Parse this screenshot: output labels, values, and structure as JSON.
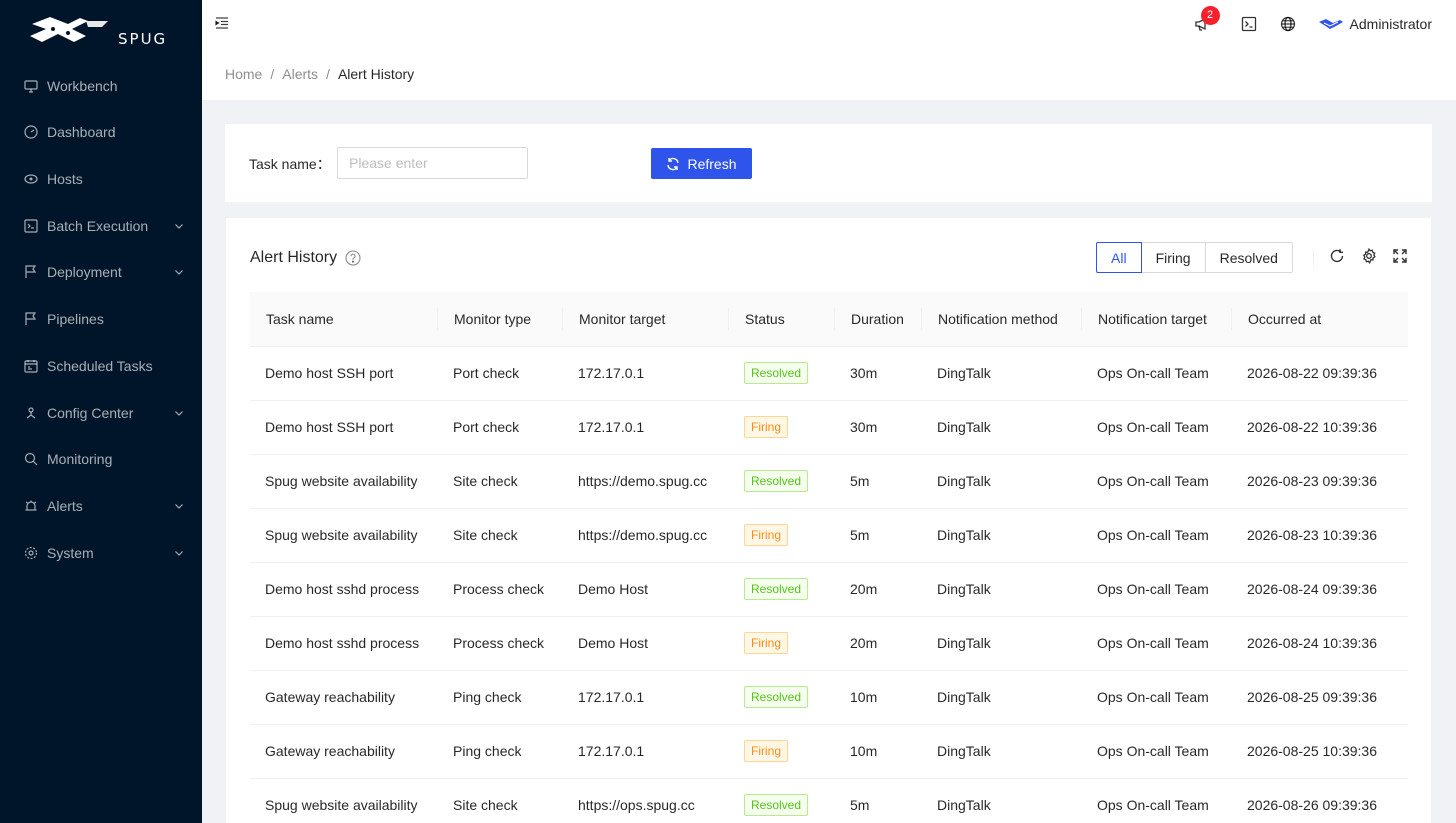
{
  "brand": {
    "logo_text": "SPUG"
  },
  "sidebar": {
    "items": [
      {
        "label": "Workbench",
        "icon": "desktop-icon",
        "has_children": false
      },
      {
        "label": "Dashboard",
        "icon": "dashboard-icon",
        "has_children": false
      },
      {
        "label": "Hosts",
        "icon": "cloud-server-icon",
        "has_children": false
      },
      {
        "label": "Batch Execution",
        "icon": "code-icon",
        "has_children": true
      },
      {
        "label": "Deployment",
        "icon": "flag-icon",
        "has_children": true
      },
      {
        "label": "Pipelines",
        "icon": "flag-icon",
        "has_children": false
      },
      {
        "label": "Scheduled Tasks",
        "icon": "schedule-icon",
        "has_children": false
      },
      {
        "label": "Config Center",
        "icon": "deployment-unit-icon",
        "has_children": true
      },
      {
        "label": "Monitoring",
        "icon": "monitor-icon",
        "has_children": false
      },
      {
        "label": "Alerts",
        "icon": "alert-icon",
        "has_children": true
      },
      {
        "label": "System",
        "icon": "setting-icon",
        "has_children": true
      }
    ]
  },
  "header": {
    "notification_count": "2",
    "username": "Administrator"
  },
  "breadcrumb": [
    "Home",
    "Alerts",
    "Alert History"
  ],
  "search": {
    "label": "Task name：",
    "placeholder": "Please enter",
    "refresh_label": "Refresh"
  },
  "table": {
    "title": "Alert History",
    "filters": [
      "All",
      "Firing",
      "Resolved"
    ],
    "active_filter": "All",
    "columns": [
      "Task name",
      "Monitor type",
      "Monitor target",
      "Status",
      "Duration",
      "Notification method",
      "Notification target",
      "Occurred at"
    ],
    "rows": [
      {
        "name": "Demo host SSH port",
        "type": "Port check",
        "target": "172.17.0.1",
        "status": "Resolved",
        "duration": "30m",
        "method": "DingTalk",
        "notify": "Ops On-call Team",
        "time": "2026-08-22 09:39:36"
      },
      {
        "name": "Demo host SSH port",
        "type": "Port check",
        "target": "172.17.0.1",
        "status": "Firing",
        "duration": "30m",
        "method": "DingTalk",
        "notify": "Ops On-call Team",
        "time": "2026-08-22 10:39:36"
      },
      {
        "name": "Spug website availability",
        "type": "Site check",
        "target": "https://demo.spug.cc",
        "status": "Resolved",
        "duration": "5m",
        "method": "DingTalk",
        "notify": "Ops On-call Team",
        "time": "2026-08-23 09:39:36"
      },
      {
        "name": "Spug website availability",
        "type": "Site check",
        "target": "https://demo.spug.cc",
        "status": "Firing",
        "duration": "5m",
        "method": "DingTalk",
        "notify": "Ops On-call Team",
        "time": "2026-08-23 10:39:36"
      },
      {
        "name": "Demo host sshd process",
        "type": "Process check",
        "target": "Demo Host",
        "status": "Resolved",
        "duration": "20m",
        "method": "DingTalk",
        "notify": "Ops On-call Team",
        "time": "2026-08-24 09:39:36"
      },
      {
        "name": "Demo host sshd process",
        "type": "Process check",
        "target": "Demo Host",
        "status": "Firing",
        "duration": "20m",
        "method": "DingTalk",
        "notify": "Ops On-call Team",
        "time": "2026-08-24 10:39:36"
      },
      {
        "name": "Gateway reachability",
        "type": "Ping check",
        "target": "172.17.0.1",
        "status": "Resolved",
        "duration": "10m",
        "method": "DingTalk",
        "notify": "Ops On-call Team",
        "time": "2026-08-25 09:39:36"
      },
      {
        "name": "Gateway reachability",
        "type": "Ping check",
        "target": "172.17.0.1",
        "status": "Firing",
        "duration": "10m",
        "method": "DingTalk",
        "notify": "Ops On-call Team",
        "time": "2026-08-25 10:39:36"
      },
      {
        "name": "Spug website availability",
        "type": "Site check",
        "target": "https://ops.spug.cc",
        "status": "Resolved",
        "duration": "5m",
        "method": "DingTalk",
        "notify": "Ops On-call Team",
        "time": "2026-08-26 09:39:36"
      }
    ]
  },
  "colors": {
    "primary": "#2f54eb",
    "sidebar_bg": "#001529",
    "resolved": "#52c41a",
    "firing": "#fa8c16",
    "badge": "#f5222d"
  }
}
